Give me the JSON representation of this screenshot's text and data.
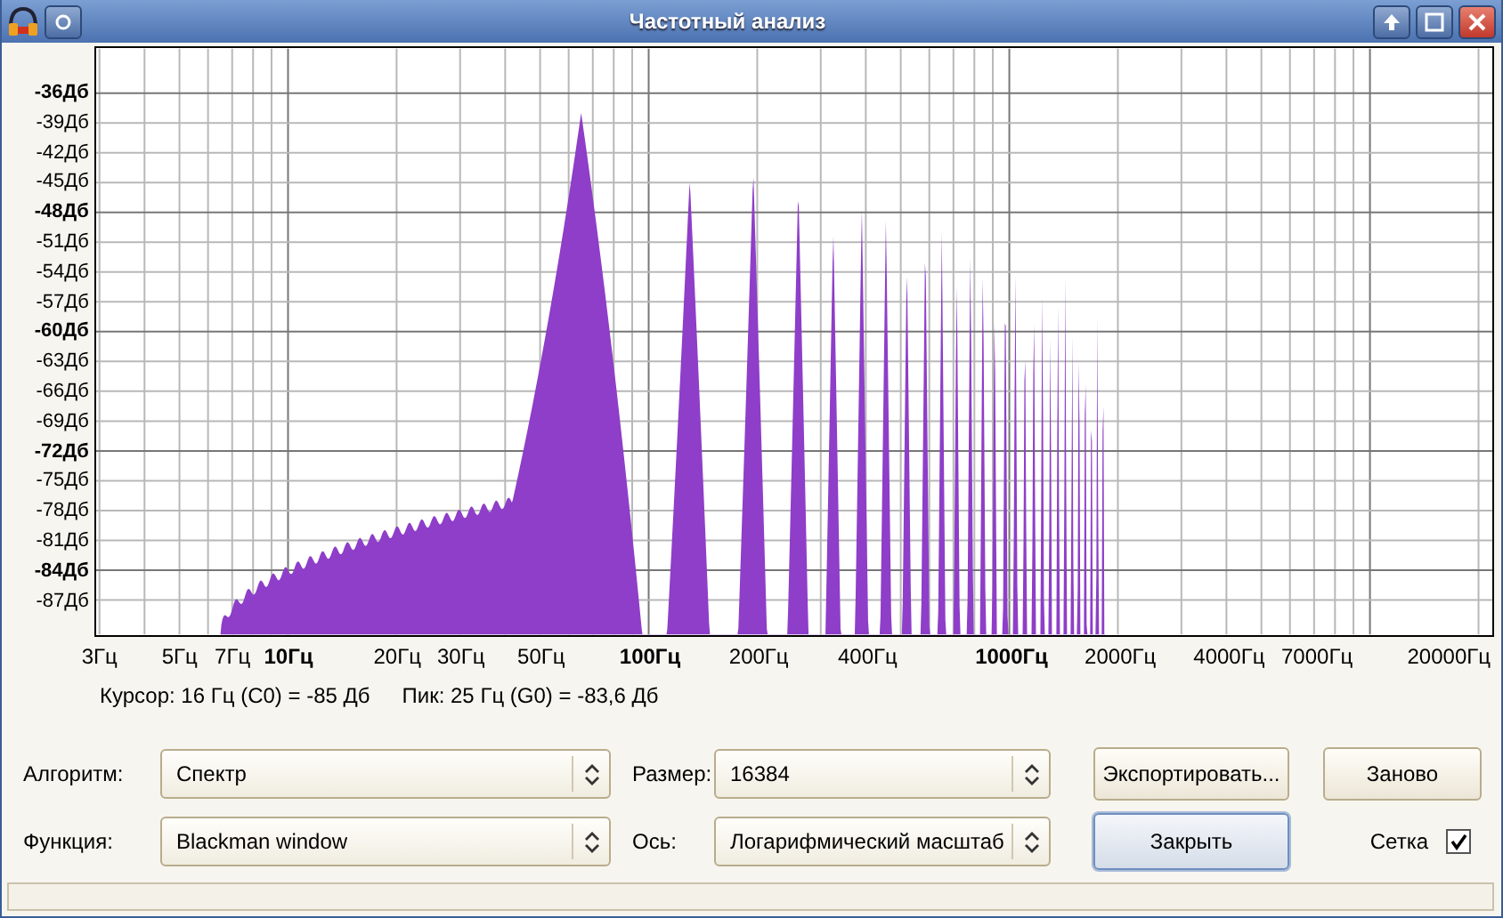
{
  "window": {
    "title": "Частотный анализ"
  },
  "plot": {
    "y_axis": [
      {
        "label": "-36Дб",
        "major": true
      },
      {
        "label": "-39Дб",
        "major": false
      },
      {
        "label": "-42Дб",
        "major": false
      },
      {
        "label": "-45Дб",
        "major": false
      },
      {
        "label": "-48Дб",
        "major": true
      },
      {
        "label": "-51Дб",
        "major": false
      },
      {
        "label": "-54Дб",
        "major": false
      },
      {
        "label": "-57Дб",
        "major": false
      },
      {
        "label": "-60Дб",
        "major": true
      },
      {
        "label": "-63Дб",
        "major": false
      },
      {
        "label": "-66Дб",
        "major": false
      },
      {
        "label": "-69Дб",
        "major": false
      },
      {
        "label": "-72Дб",
        "major": true
      },
      {
        "label": "-75Дб",
        "major": false
      },
      {
        "label": "-78Дб",
        "major": false
      },
      {
        "label": "-81Дб",
        "major": false
      },
      {
        "label": "-84Дб",
        "major": true
      },
      {
        "label": "-87Дб",
        "major": false
      }
    ],
    "x_axis": [
      {
        "label": "3Гц",
        "major": false
      },
      {
        "label": "5Гц",
        "major": false
      },
      {
        "label": "7Гц",
        "major": false
      },
      {
        "label": "10Гц",
        "major": true
      },
      {
        "label": "20Гц",
        "major": false
      },
      {
        "label": "30Гц",
        "major": false
      },
      {
        "label": "50Гц",
        "major": false
      },
      {
        "label": "100Гц",
        "major": true
      },
      {
        "label": "200Гц",
        "major": false
      },
      {
        "label": "400Гц",
        "major": false
      },
      {
        "label": "1000Гц",
        "major": true
      },
      {
        "label": "2000Гц",
        "major": false
      },
      {
        "label": "4000Гц",
        "major": false
      },
      {
        "label": "7000Гц",
        "major": false
      },
      {
        "label": "20000Гц",
        "major": false
      }
    ]
  },
  "readout": {
    "cursor": "Курсор: 16 Гц (C0) = -85 Дб",
    "peak": "Пик: 25 Гц (G0) = -83,6 Дб"
  },
  "settings": [
    {
      "label": "Алгоритм:",
      "value": "Спектр"
    },
    {
      "label": "Размер:",
      "value": "16384"
    },
    {
      "label": "Функция:",
      "value": "Blackman window"
    },
    {
      "label": "Ось:",
      "value": "Логарифмический масштаб"
    }
  ],
  "buttons": [
    {
      "label": "Экспортировать...",
      "default": false
    },
    {
      "label": "Заново",
      "default": false
    },
    {
      "label": "Закрыть",
      "default": true
    }
  ],
  "grid_checkbox": {
    "label": "Сетка",
    "checked": true
  }
}
